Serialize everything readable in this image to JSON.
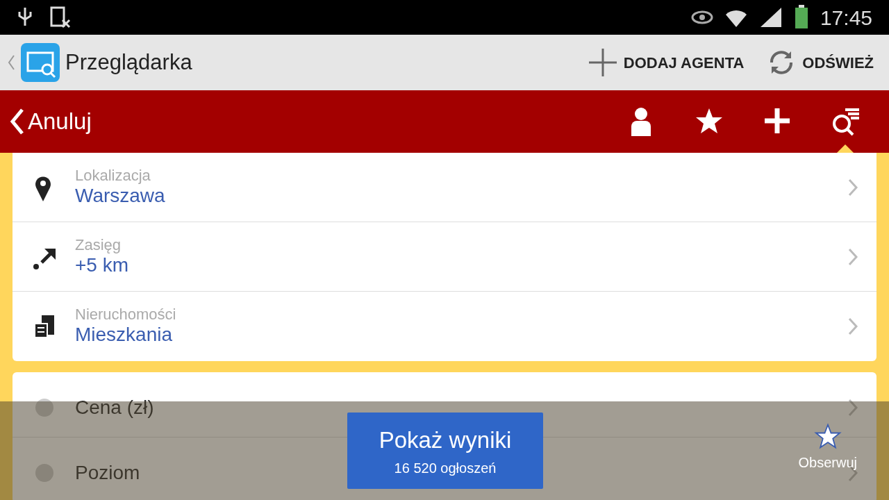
{
  "status_bar": {
    "time": "17:45"
  },
  "action_bar": {
    "title": "Przeglądarka",
    "actions": [
      {
        "kind": "add",
        "label": "DODAJ AGENTA"
      },
      {
        "kind": "refresh",
        "label": "ODŚWIEŻ"
      }
    ]
  },
  "toolbar": {
    "back_label": "Anuluj",
    "icons": [
      {
        "kind": "person",
        "selected": false
      },
      {
        "kind": "star",
        "selected": false
      },
      {
        "kind": "plus",
        "selected": false
      },
      {
        "kind": "search-filter",
        "selected": true
      }
    ]
  },
  "sections": [
    {
      "rows": [
        {
          "kind": "pin",
          "label": "Lokalizacja",
          "value": "Warszawa"
        },
        {
          "kind": "range",
          "label": "Zasięg",
          "value": "+5 km"
        },
        {
          "kind": "building",
          "label": "Nieruchomości",
          "value": "Mieszkania"
        }
      ]
    },
    {
      "rows": [
        {
          "kind": "dot",
          "label": "Cena (zł)"
        },
        {
          "kind": "dot",
          "label": "Poziom"
        }
      ]
    }
  ],
  "bottom_bar": {
    "button_title": "Pokaż wyniki",
    "button_subtitle": "16 520 ogłoszeń",
    "watch_label": "Obserwuj"
  }
}
